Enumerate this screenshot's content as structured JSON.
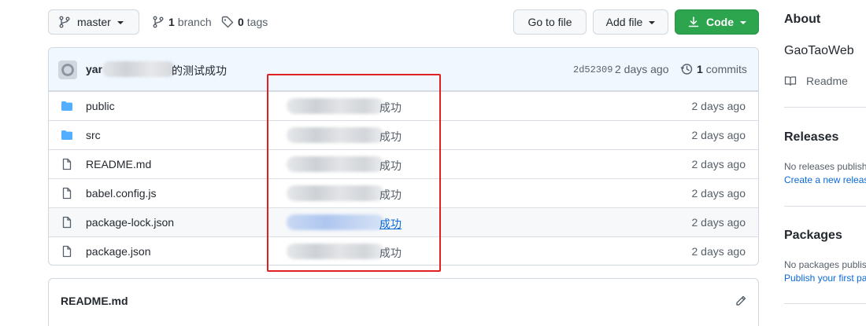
{
  "toolbar": {
    "branch_name": "master",
    "branch_count": "1",
    "branch_label": "branch",
    "tag_count": "0",
    "tag_label": "tags",
    "goto_file": "Go to file",
    "add_file": "Add file",
    "code": "Code"
  },
  "commit": {
    "author": "yar",
    "message_visible": "的测试成功",
    "sha": "2d52309",
    "time": "2 days ago",
    "commits_count": "1",
    "commits_label": "commits"
  },
  "files": [
    {
      "name": "public",
      "type": "folder",
      "message_suffix": "成功",
      "time": "2 days ago"
    },
    {
      "name": "src",
      "type": "folder",
      "message_suffix": "成功",
      "time": "2 days ago"
    },
    {
      "name": "README.md",
      "type": "file",
      "message_suffix": "成功",
      "time": "2 days ago"
    },
    {
      "name": "babel.config.js",
      "type": "file",
      "message_suffix": "成功",
      "time": "2 days ago"
    },
    {
      "name": "package-lock.json",
      "type": "file",
      "message_suffix": "成功",
      "time": "2 days ago"
    },
    {
      "name": "package.json",
      "type": "file",
      "message_suffix": "成功",
      "time": "2 days ago"
    }
  ],
  "readme": {
    "title": "README.md"
  },
  "sidebar": {
    "about_title": "About",
    "description": "GaoTaoWeb",
    "readme_label": "Readme",
    "releases_title": "Releases",
    "releases_empty": "No releases publishe",
    "releases_link": "Create a new release",
    "packages_title": "Packages",
    "packages_empty": "No packages publis",
    "packages_link": "Publish your first pa"
  },
  "colors": {
    "accent": "#2da44e",
    "link": "#0969da",
    "highlight_box": "#e02020",
    "folder_icon": "#54aeff"
  }
}
